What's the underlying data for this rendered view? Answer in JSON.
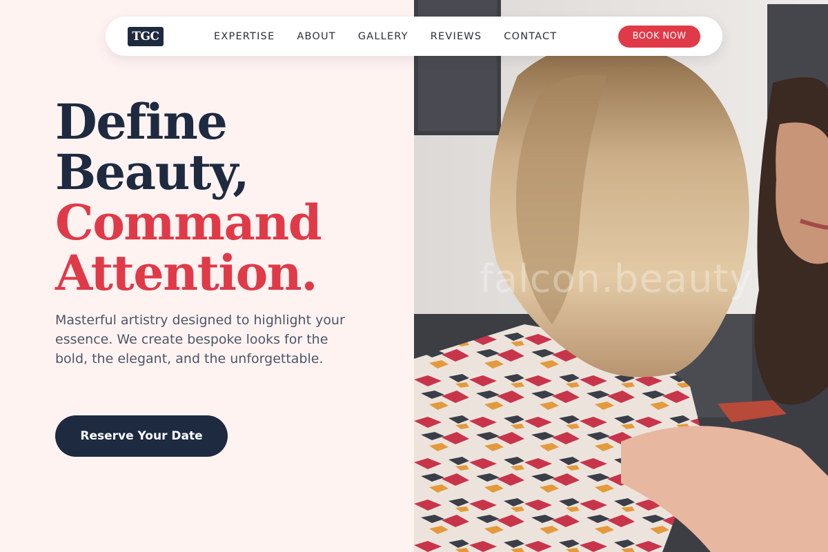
{
  "brand": {
    "logo_text": "TGC"
  },
  "nav": {
    "links": [
      {
        "label": "EXPERTISE"
      },
      {
        "label": "ABOUT"
      },
      {
        "label": "GALLERY"
      },
      {
        "label": "REVIEWS"
      },
      {
        "label": "CONTACT"
      }
    ],
    "cta_label": "BOOK NOW"
  },
  "hero": {
    "headline_line1": "Define",
    "headline_line2": "Beauty,",
    "headline_line3": "Command",
    "headline_line4": "Attention.",
    "subtext": "Masterful artistry designed to highlight your essence. We create bespoke looks for the bold, the elegant, and the unforgettable.",
    "cta_label": "Reserve Your Date"
  },
  "photo": {
    "watermark": "falcon.beauty"
  },
  "colors": {
    "navy": "#1e2a40",
    "accent_red": "#e03a48",
    "background_blush": "#fff3f2"
  }
}
